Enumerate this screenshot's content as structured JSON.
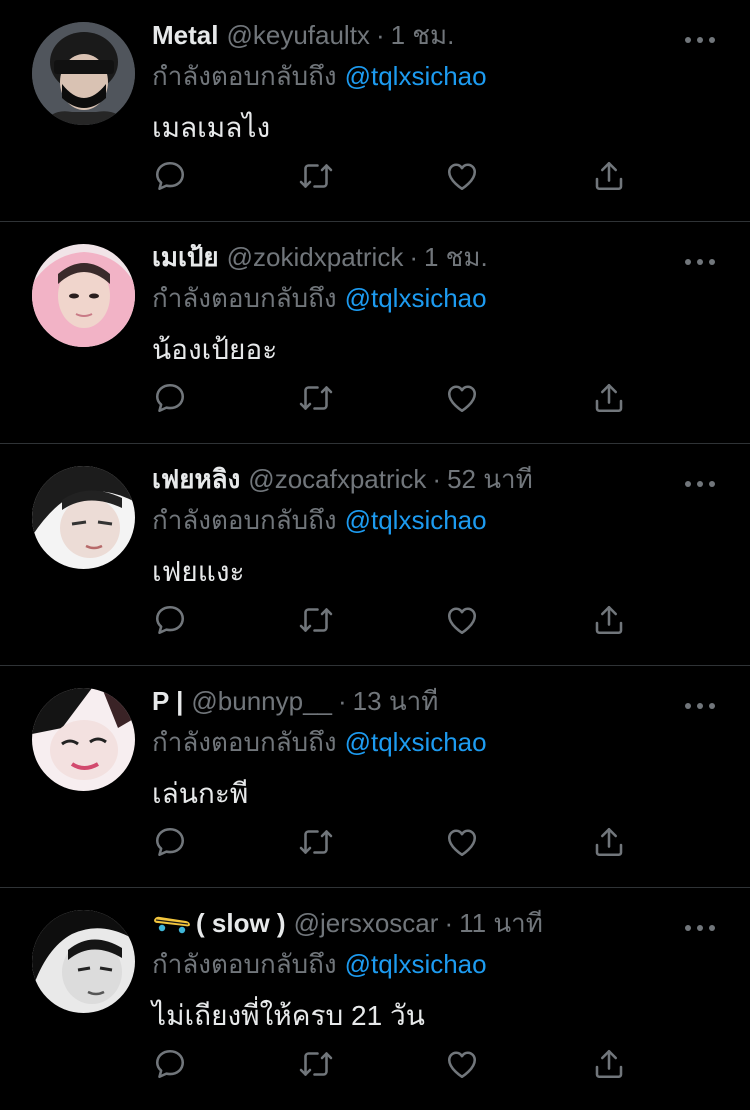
{
  "colors": {
    "background": "#000000",
    "separator": "#2f3336",
    "muted": "#71767b",
    "link": "#1d9bf0",
    "text": "#e7e9ea"
  },
  "icons": {
    "more": "more-dots-icon",
    "reply": "reply-icon",
    "retweet": "retweet-icon",
    "like": "heart-icon",
    "share": "share-icon"
  },
  "tweets": [
    {
      "display_name": "Metal",
      "handle": "@keyufaultx",
      "separator": "·",
      "time": "1 ชม.",
      "reply_prefix": "กำลังตอบกลับถึง",
      "mention": "@tqlxsichao",
      "text": "เมลเมลไง"
    },
    {
      "display_name": "เมเป้ย",
      "handle": "@zokidxpatrick",
      "separator": "·",
      "time": "1 ชม.",
      "reply_prefix": "กำลังตอบกลับถึง",
      "mention": "@tqlxsichao",
      "text": "น้องเป้ยอะ"
    },
    {
      "display_name": "เฟยหลิง",
      "handle": "@zocafxpatrick",
      "separator": "·",
      "time": "52 นาที",
      "reply_prefix": "กำลังตอบกลับถึง",
      "mention": "@tqlxsichao",
      "text": "เฟยแงะ"
    },
    {
      "display_name": "P |",
      "handle": "@bunnyp__",
      "separator": "·",
      "time": "13 นาที",
      "reply_prefix": "กำลังตอบกลับถึง",
      "mention": "@tqlxsichao",
      "text": "เล่นกะพี"
    },
    {
      "display_name": "( slow )",
      "display_emoji": "skateboard-emoji",
      "handle": "@jersxoscar",
      "separator": "·",
      "time": "11 นาที",
      "reply_prefix": "กำลังตอบกลับถึง",
      "mention": "@tqlxsichao",
      "text": "ไม่เถียงพี่ให้ครบ 21 วัน"
    }
  ]
}
